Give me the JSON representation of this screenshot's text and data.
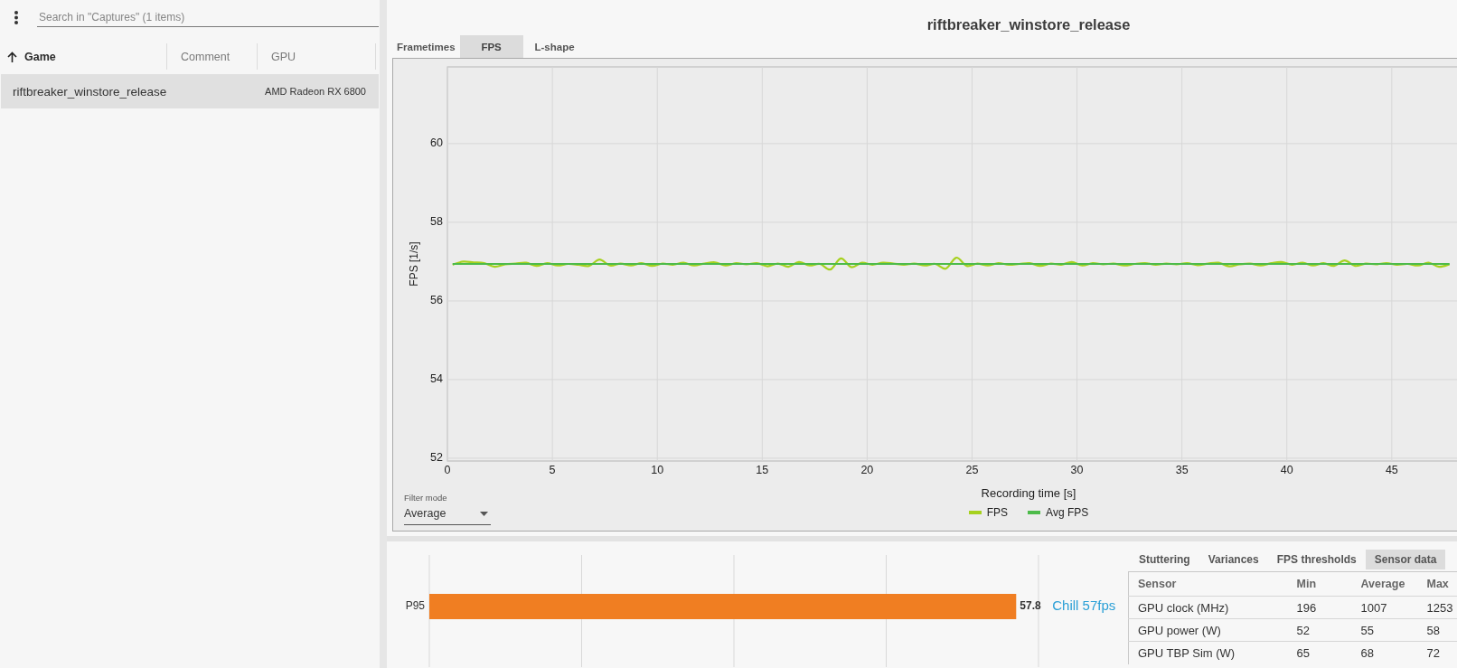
{
  "captures_panel": {
    "search": {
      "placeholder": "Search in \"Captures\" (1 items)"
    },
    "table": {
      "columns": [
        {
          "label": "Game",
          "sorted": true
        },
        {
          "label": "Comment",
          "sorted": false
        },
        {
          "label": "GPU",
          "sorted": false
        }
      ],
      "rows": [
        {
          "selected": true,
          "game": "riftbreaker_winstore_release",
          "gpu": "AMD Radeon RX 6800"
        }
      ]
    }
  },
  "analysis_panel": {
    "title": "riftbreaker_winstore_release",
    "tabs": [
      {
        "label": "Frametimes",
        "selected": false
      },
      {
        "label": "FPS",
        "selected": true
      },
      {
        "label": "L-shape",
        "selected": false
      }
    ],
    "chart": {
      "filter_mode": {
        "label": "Filter mode",
        "value": "Average"
      },
      "chart_data": {
        "type": "line",
        "xlabel": "Recording time [s]",
        "ylabel": "FPS [1/s]",
        "x": [
          0.25,
          0.75,
          1.25,
          1.75,
          2.25,
          2.75,
          3.25,
          3.75,
          4.25,
          4.75,
          5.25,
          5.75,
          6.25,
          6.75,
          7.25,
          7.75,
          8.25,
          8.75,
          9.25,
          9.75,
          10.25,
          10.75,
          11.25,
          11.75,
          12.25,
          12.75,
          13.25,
          13.75,
          14.25,
          14.75,
          15.25,
          15.75,
          16.25,
          16.75,
          17.25,
          17.75,
          18.25,
          18.75,
          19.25,
          19.75,
          20.25,
          20.75,
          21.25,
          21.75,
          22.25,
          22.75,
          23.25,
          23.75,
          24.25,
          24.75,
          25.25,
          25.75,
          26.25,
          26.75,
          27.25,
          27.75,
          28.25,
          28.75,
          29.25,
          29.75,
          30.25,
          30.75,
          31.25,
          31.75,
          32.25,
          32.75,
          33.25,
          33.75,
          34.25,
          34.75,
          35.25,
          35.75,
          36.25,
          36.75,
          37.25,
          37.75,
          38.25,
          38.75,
          39.25,
          39.75,
          40.25,
          40.75,
          41.25,
          41.75,
          42.25,
          42.75,
          43.25,
          43.75,
          44.25,
          44.75,
          45.25,
          45.75,
          46.25,
          46.75,
          47.25,
          47.75
        ],
        "series": [
          {
            "name": "FPS",
            "color": "#a6d11e",
            "values": [
              56.92,
              57.0,
              56.98,
              56.96,
              56.87,
              56.93,
              56.95,
              56.97,
              56.89,
              56.96,
              56.9,
              56.94,
              56.92,
              56.89,
              57.05,
              56.9,
              56.95,
              56.9,
              56.96,
              56.89,
              56.95,
              56.92,
              56.97,
              56.9,
              56.95,
              56.98,
              56.9,
              56.96,
              56.93,
              56.96,
              56.88,
              56.95,
              56.87,
              56.99,
              56.9,
              56.94,
              56.8,
              57.08,
              56.86,
              56.97,
              56.92,
              56.97,
              56.95,
              56.92,
              56.95,
              56.9,
              56.94,
              56.82,
              57.1,
              56.89,
              56.95,
              56.9,
              56.96,
              56.92,
              56.94,
              56.96,
              56.89,
              56.95,
              56.92,
              56.99,
              56.9,
              56.96,
              56.93,
              56.95,
              56.9,
              56.94,
              56.96,
              56.92,
              56.95,
              56.93,
              56.96,
              56.91,
              56.95,
              56.97,
              56.88,
              56.93,
              56.95,
              56.9,
              56.96,
              56.99,
              56.92,
              56.97,
              56.9,
              56.96,
              56.89,
              57.03,
              56.89,
              56.95,
              56.93,
              56.96,
              56.92,
              56.94,
              56.9,
              56.97,
              56.87,
              56.93
            ]
          },
          {
            "name": "Avg FPS",
            "color": "#4dbb4a",
            "values": [
              56.94,
              56.94,
              56.94,
              56.94,
              56.94,
              56.94,
              56.94,
              56.94,
              56.94,
              56.94,
              56.94,
              56.94,
              56.94,
              56.94,
              56.94,
              56.94,
              56.94,
              56.94,
              56.94,
              56.94,
              56.94,
              56.94,
              56.94,
              56.94,
              56.94,
              56.94,
              56.94,
              56.94,
              56.94,
              56.94,
              56.94,
              56.94,
              56.94,
              56.94,
              56.94,
              56.94,
              56.94,
              56.94,
              56.94,
              56.94,
              56.94,
              56.94,
              56.94,
              56.94,
              56.94,
              56.94,
              56.94,
              56.94,
              56.94,
              56.94,
              56.94,
              56.94,
              56.94,
              56.94,
              56.94,
              56.94,
              56.94,
              56.94,
              56.94,
              56.94,
              56.94,
              56.94,
              56.94,
              56.94,
              56.94,
              56.94,
              56.94,
              56.94,
              56.94,
              56.94,
              56.94,
              56.94,
              56.94,
              56.94,
              56.94,
              56.94,
              56.94,
              56.94,
              56.94,
              56.94,
              56.94,
              56.94,
              56.94,
              56.94,
              56.94,
              56.94,
              56.94,
              56.94,
              56.94,
              56.94,
              56.94,
              56.94,
              56.94,
              56.94,
              56.94,
              56.94
            ]
          }
        ],
        "xlim": [
          0,
          48.15
        ],
        "ylim": [
          51.93,
          61.95
        ],
        "xticks": [
          0,
          5,
          10,
          15,
          20,
          25,
          30,
          35,
          40,
          45
        ],
        "yticks": [
          {
            "value": 52,
            "label": "52"
          },
          {
            "value": 54,
            "label": "54"
          },
          {
            "value": 56,
            "label": "56"
          },
          {
            "value": 58,
            "label": "58"
          },
          {
            "value": 60,
            "label": "60"
          }
        ],
        "grid": true,
        "legend": "bottom"
      }
    }
  },
  "summary_panel": {
    "bar_chart": {
      "chart_data": {
        "type": "bar",
        "orientation": "horizontal",
        "categories": [
          "P95"
        ],
        "series": [
          {
            "name": "Chill 57fps",
            "color": "#f07e22",
            "values": [
              57.8
            ]
          }
        ],
        "grid": true,
        "data_labels": true
      }
    },
    "tabs": [
      {
        "label": "Stuttering",
        "selected": false
      },
      {
        "label": "Variances",
        "selected": false
      },
      {
        "label": "FPS thresholds",
        "selected": false
      },
      {
        "label": "Sensor data",
        "selected": true
      }
    ],
    "sensor_table": {
      "columns": [
        "Sensor",
        "Min",
        "Average",
        "Max"
      ],
      "rows": [
        {
          "cells": [
            "GPU clock (MHz)",
            "196",
            "1007",
            "1253"
          ]
        },
        {
          "cells": [
            "GPU power (W)",
            "52",
            "55",
            "58"
          ]
        },
        {
          "cells": [
            "GPU TBP Sim (W)",
            "65",
            "68",
            "72"
          ]
        }
      ]
    }
  }
}
